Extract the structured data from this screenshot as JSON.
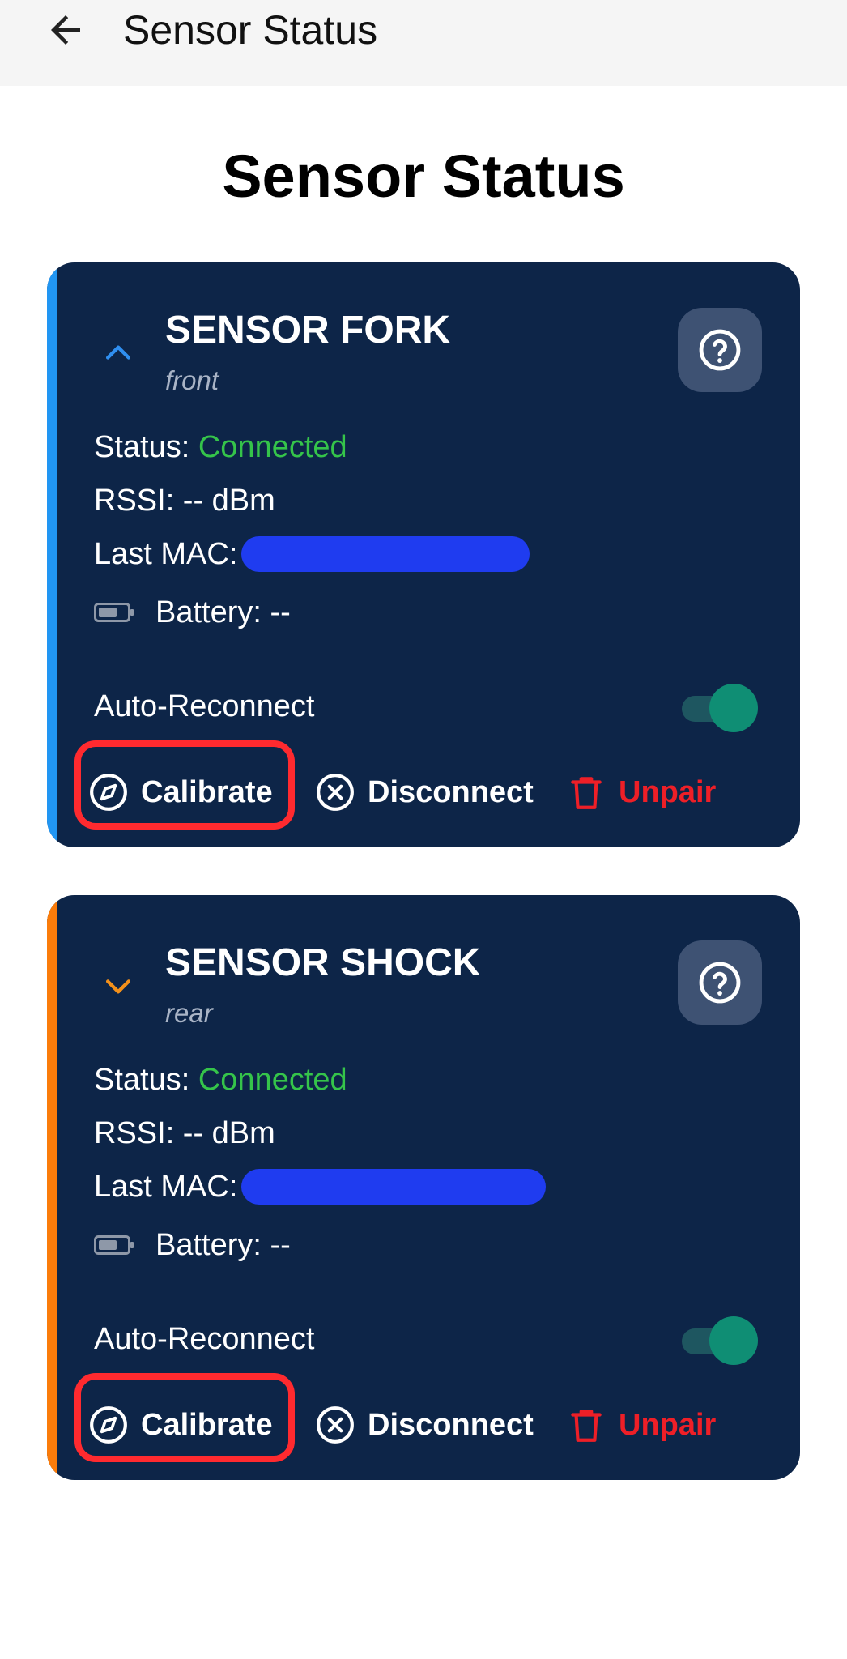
{
  "app_bar": {
    "title": "Sensor Status"
  },
  "page": {
    "title": "Sensor Status"
  },
  "sensors": [
    {
      "name": "SENSOR FORK",
      "position": "front",
      "accent_color": "#2196f3",
      "expanded": true,
      "status_label": "Status:",
      "status_value": "Connected",
      "rssi": "RSSI: -- dBm",
      "mac_label": "Last MAC:",
      "battery": "Battery: --",
      "auto_reconnect_label": "Auto-Reconnect",
      "auto_reconnect_on": true,
      "actions": {
        "calibrate": "Calibrate",
        "disconnect": "Disconnect",
        "unpair": "Unpair"
      }
    },
    {
      "name": "SENSOR SHOCK",
      "position": "rear",
      "accent_color": "#fb7c0a",
      "expanded": false,
      "status_label": "Status:",
      "status_value": "Connected",
      "rssi": "RSSI: -- dBm",
      "mac_label": "Last MAC:",
      "battery": "Battery: --",
      "auto_reconnect_label": "Auto-Reconnect",
      "auto_reconnect_on": true,
      "actions": {
        "calibrate": "Calibrate",
        "disconnect": "Disconnect",
        "unpair": "Unpair"
      }
    }
  ],
  "colors": {
    "card_background": "#0d2548",
    "connected": "#35c44a",
    "unpair": "#ee1f27",
    "highlight": "#ff2a2f",
    "toggle_on": "#0f8e74"
  }
}
